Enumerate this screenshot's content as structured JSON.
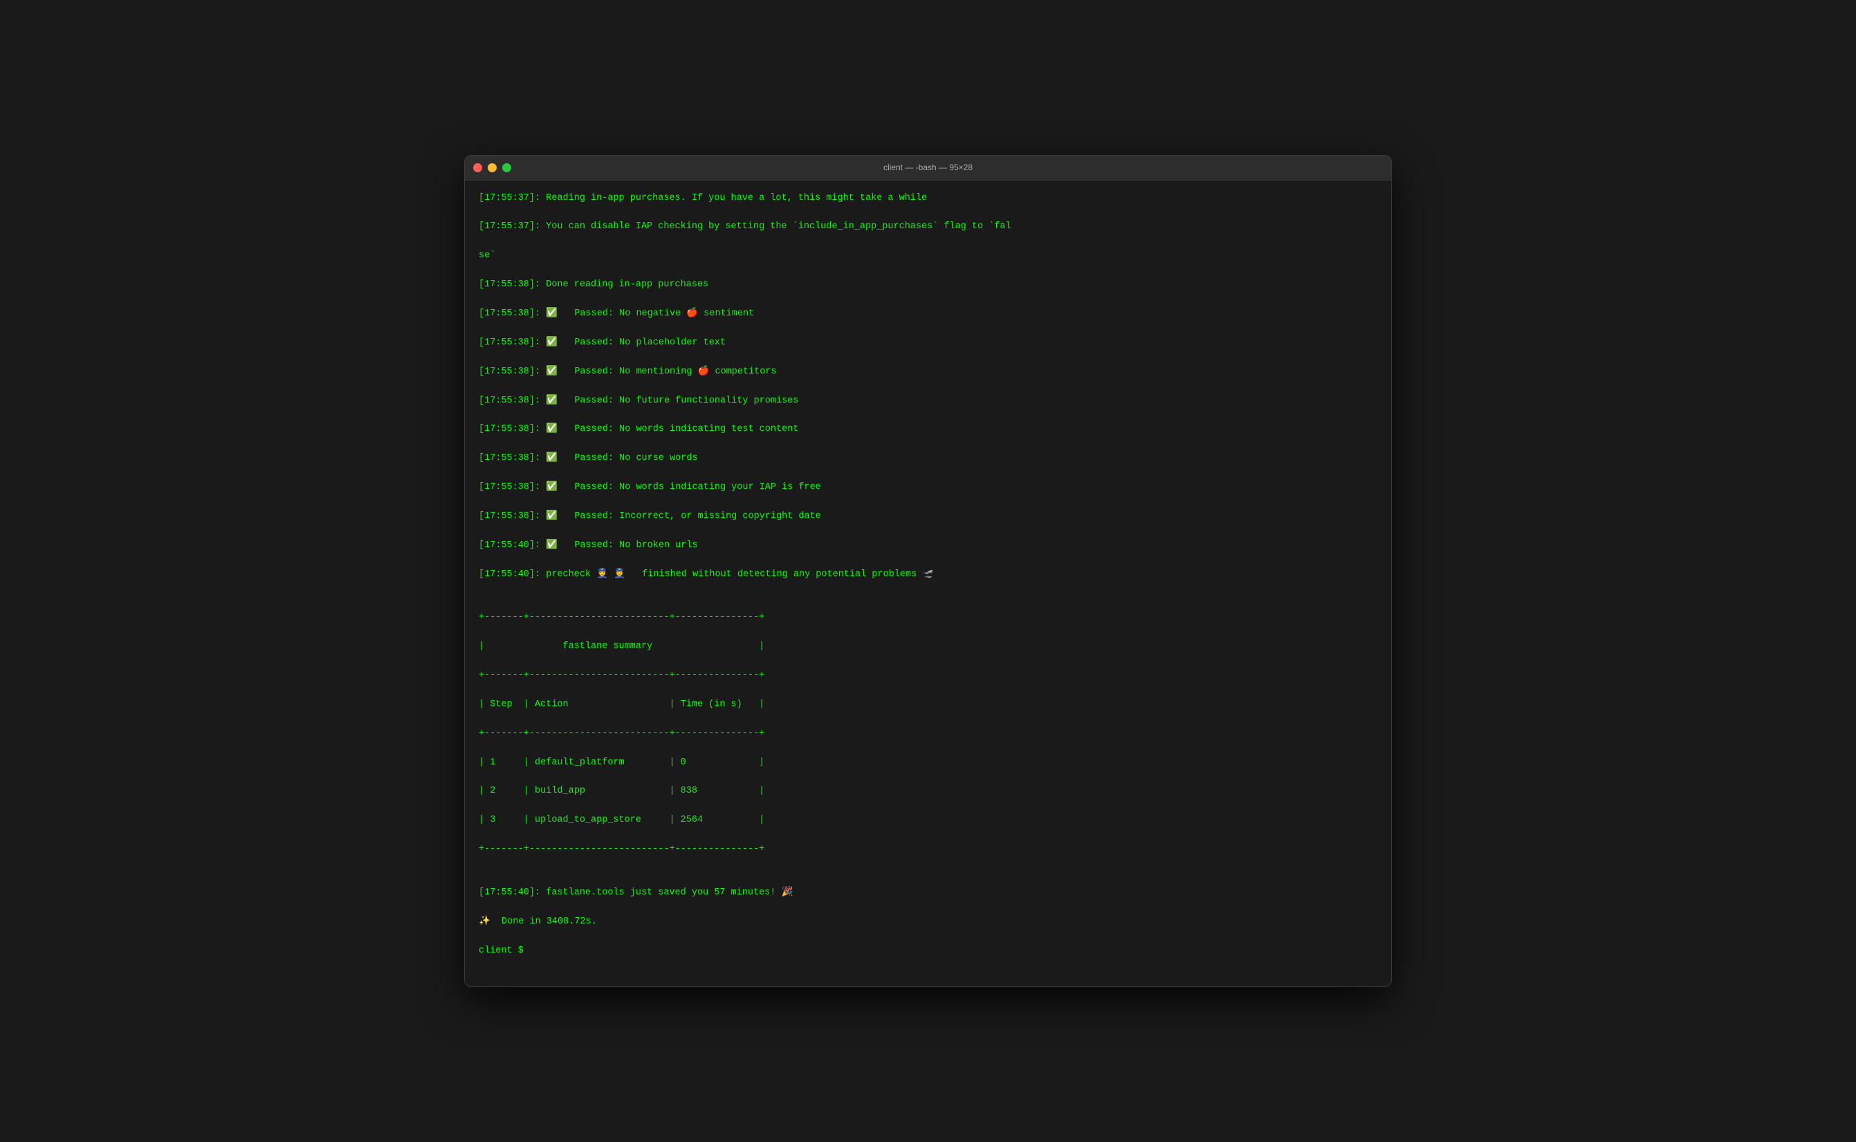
{
  "window": {
    "title": "client — -bash — 95×28",
    "traffic_lights": [
      "red",
      "yellow",
      "green"
    ]
  },
  "terminal": {
    "lines": [
      "[17:55:37]: Reading in-app purchases. If you have a lot, this might take a while",
      "[17:55:37]: You can disable IAP checking by setting the `include_in_app_purchases` flag to `fal",
      "se`",
      "[17:55:38]: Done reading in-app purchases",
      "[17:55:38]: ✅   Passed: No negative 🍎 sentiment",
      "[17:55:38]: ✅   Passed: No placeholder text",
      "[17:55:38]: ✅   Passed: No mentioning 🍎 competitors",
      "[17:55:38]: ✅   Passed: No future functionality promises",
      "[17:55:38]: ✅   Passed: No words indicating test content",
      "[17:55:38]: ✅   Passed: No curse words",
      "[17:55:38]: ✅   Passed: No words indicating your IAP is free",
      "[17:55:38]: ✅   Passed: Incorrect, or missing copyright date",
      "[17:55:40]: ✅   Passed: No broken urls",
      "[17:55:40]: precheck 👮 👮   finished without detecting any potential problems 🛫",
      "",
      "+-------+-------------------------+---------------+",
      "|              fastlane summary                   |",
      "+-------+-------------------------+---------------+",
      "| Step  | Action                  | Time (in s)   |",
      "+-------+-------------------------+---------------+",
      "| 1     | default_platform        | 0             |",
      "| 2     | build_app               | 838           |",
      "| 3     | upload_to_app_store     | 2564          |",
      "+-------+-------------------------+---------------+",
      "",
      "[17:55:40]: fastlane.tools just saved you 57 minutes! 🎉",
      "✨  Done in 3408.72s.",
      "client $ "
    ]
  }
}
